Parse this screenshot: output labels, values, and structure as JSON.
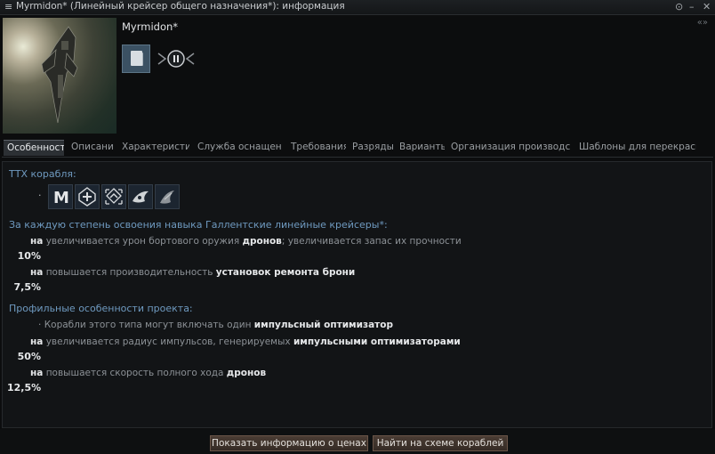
{
  "window": {
    "title": "Myrmidon* (Линейный крейсер общего назначения*): информация",
    "menu_icon": "hamburger-icon",
    "controls": [
      "⊙",
      "–",
      "✕"
    ],
    "collapse_glyph": "«»"
  },
  "header": {
    "ship_name": "Myrmidon*",
    "buttons": [
      "show-info-icon",
      "skill-icon"
    ]
  },
  "tabs": [
    {
      "label": "Особенности",
      "active": true
    },
    {
      "label": "Описание"
    },
    {
      "label": "Характеристики"
    },
    {
      "label": "Служба оснащения"
    },
    {
      "label": "Требования"
    },
    {
      "label": "Разряды"
    },
    {
      "label": "Варианты"
    },
    {
      "label": "Организация производства"
    },
    {
      "label": "Шаблоны для перекраски"
    }
  ],
  "traits": {
    "ttx_heading": "ТТХ корабля:",
    "role_icons": [
      "medium-size-icon",
      "repair-icon",
      "burst-projector-icon",
      "drone-icon",
      "drone-ship-icon"
    ],
    "skill_heading": "За каждую степень освоения навыка Галлентские линейные крейсеры*:",
    "skill_bonuses": [
      {
        "pct": "10%",
        "prefix": "на",
        "text": "увеличивается урон бортового оружия",
        "kw": "дронов",
        "text2": "; увеличивается запас их прочности"
      },
      {
        "pct": "7,5%",
        "prefix": "на",
        "text": "повышается производительность",
        "kw": "установок ремонта брони",
        "text2": ""
      }
    ],
    "role_heading": "Профильные особенности проекта:",
    "role_bullet": {
      "text": "Корабли этого типа могут включать один",
      "kw": "импульсный оптимизатор"
    },
    "role_bonuses": [
      {
        "pct": "50%",
        "prefix": "на",
        "text": "увеличивается радиус импульсов, генерируемых",
        "kw": "импульсными оптимизаторами"
      },
      {
        "pct": "12,5%",
        "prefix": "на",
        "text": "повышается скорость полного хода",
        "kw": "дронов"
      }
    ]
  },
  "footer": {
    "price_button": "Показать информацию о ценах",
    "tree_button": "Найти на схеме кораблей"
  },
  "colors": {
    "heading": "#6f9ac0",
    "keyword": "#e6e8ea",
    "active_tab": "#2c3034",
    "button": "#4a3c33"
  }
}
